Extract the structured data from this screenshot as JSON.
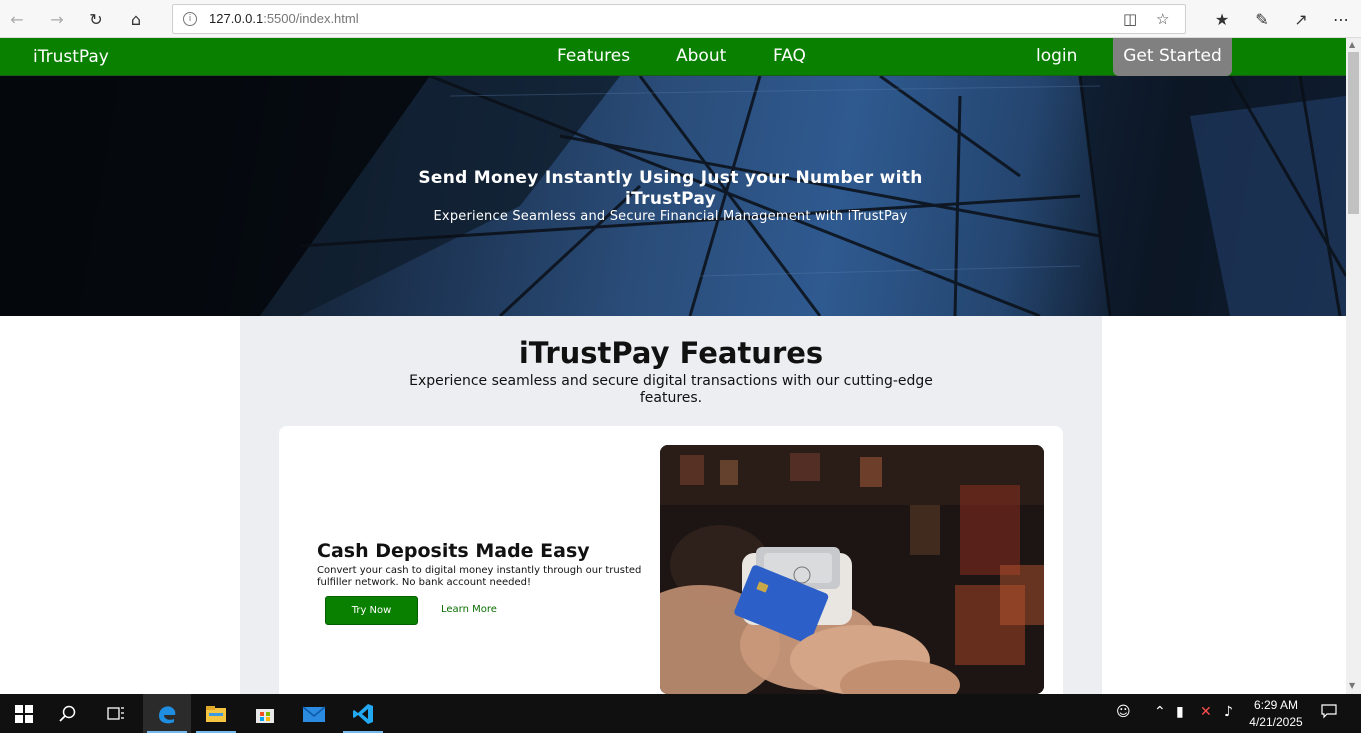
{
  "browser": {
    "url_host": "127.0.0.1",
    "url_rest": ":5500/index.html",
    "icons": [
      "back-icon",
      "forward-icon",
      "refresh-icon",
      "home-icon",
      "info-icon",
      "reading-view-icon",
      "favorite-star-icon",
      "favorites-list-icon",
      "pen-icon",
      "share-icon",
      "more-icon"
    ]
  },
  "site_nav": {
    "brand": "iTrustPay",
    "links": [
      "Features",
      "About",
      "FAQ"
    ],
    "login": "login",
    "cta": "Get Started",
    "colors": {
      "nav_bg": "#0a8000",
      "cta_bg": "#808080"
    }
  },
  "hero": {
    "title": "Send Money Instantly Using Just your Number with iTrustPay",
    "subtitle": "Experience Seamless and Secure Financial Management with iTrustPay"
  },
  "features": {
    "title": "iTrustPay Features",
    "subtitle": "Experience seamless and secure digital transactions with our cutting-edge features.",
    "card": {
      "title": "Cash Deposits Made Easy",
      "description": "Convert your cash to digital money instantly through our trusted fulfiller network. No bank account needed!",
      "primary_button": "Try Now",
      "secondary_link": "Learn More",
      "image": "card-payment-terminal-photo"
    }
  },
  "taskbar": {
    "apps": [
      "start-icon",
      "search-icon",
      "task-view-icon",
      "edge-icon",
      "file-explorer-icon",
      "store-icon",
      "mail-icon",
      "vscode-icon"
    ],
    "time": "6:29 AM",
    "date": "4/21/2025"
  }
}
